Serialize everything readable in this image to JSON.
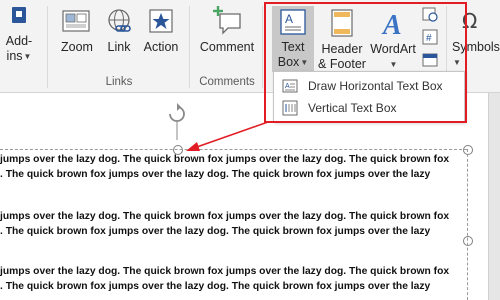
{
  "ribbon": {
    "addins": {
      "line1": "Add-",
      "line2": "ins"
    },
    "links_group": {
      "zoom": "Zoom",
      "link": "Link",
      "action": "Action",
      "label": "Links"
    },
    "comments_group": {
      "comment": "Comment",
      "label": "Comments"
    },
    "text_group": {
      "textbox": {
        "line1": "Text",
        "line2": "Box"
      },
      "header_footer": {
        "line1": "Header",
        "line2": "& Footer"
      },
      "wordart": "WordArt"
    },
    "symbols": "Symbols"
  },
  "dropdown": {
    "items": [
      {
        "label": "Draw Horizontal Text Box"
      },
      {
        "label": "Vertical Text Box"
      }
    ]
  },
  "document": {
    "lines": [
      "jumps over the lazy dog. The quick brown fox jumps over the lazy dog. The quick brown fox",
      ". The quick brown fox jumps over the lazy dog. The quick brown fox jumps over the lazy",
      "jumps over the lazy dog. The quick brown fox jumps over the lazy dog. The quick brown fox",
      ". The quick brown fox jumps over the lazy dog. The quick brown fox jumps over the lazy",
      "jumps over the lazy dog. The quick brown fox jumps over the lazy dog. The quick brown fox",
      ". The quick brown fox jumps over the lazy dog. The quick brown fox jumps over the lazy"
    ]
  },
  "colors": {
    "highlight": "#e21c24",
    "ribbon_icon_blue": "#2b579a",
    "wordart_blue": "#3b73c5"
  }
}
